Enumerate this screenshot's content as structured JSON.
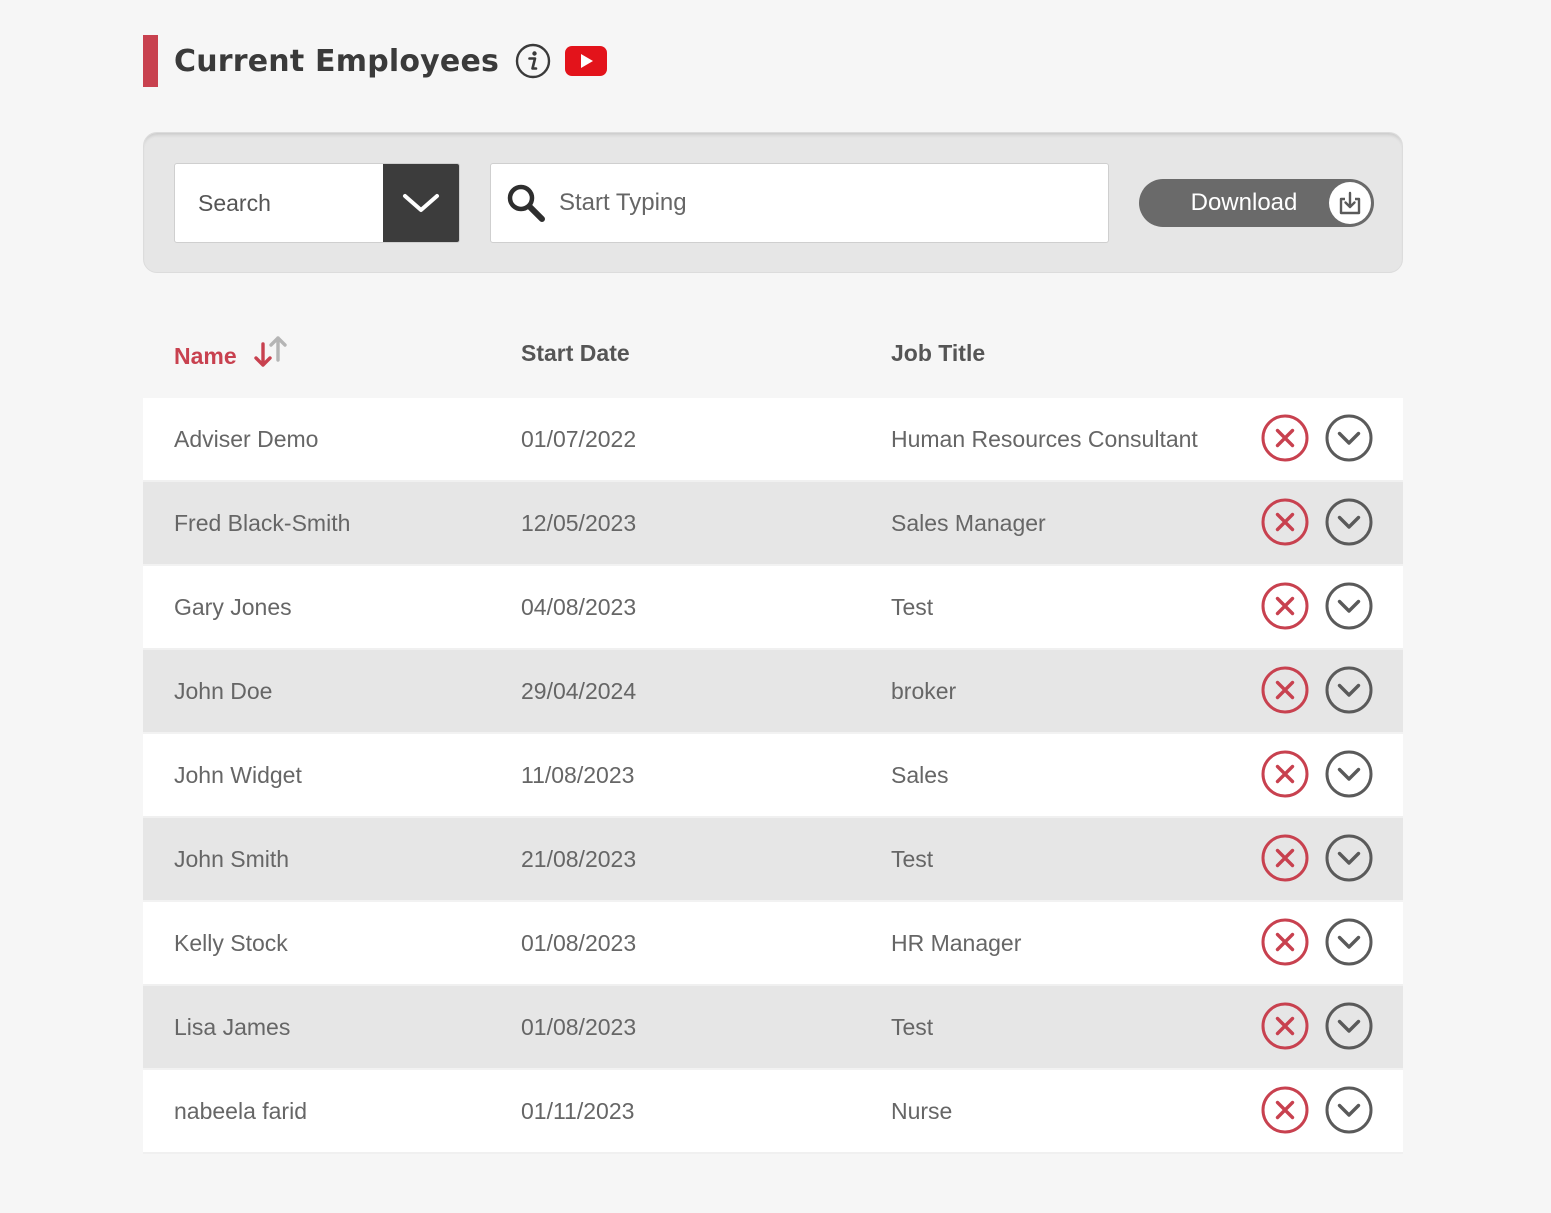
{
  "header": {
    "title": "Current Employees",
    "accent_color": "#c8414f",
    "info_icon": "info-icon",
    "video_icon": "youtube-icon"
  },
  "toolbar": {
    "search_select": {
      "value": "Search",
      "caret_icon": "chevron-down-icon"
    },
    "search_input": {
      "placeholder": "Start Typing",
      "value": "",
      "icon": "search-icon"
    },
    "download": {
      "label": "Download",
      "icon": "download-icon"
    }
  },
  "table": {
    "columns": {
      "name": "Name",
      "start_date": "Start Date",
      "job_title": "Job Title"
    },
    "sort": {
      "column": "name",
      "icon": "sort-icon"
    },
    "rows": [
      {
        "name": "Adviser Demo",
        "start_date": "01/07/2022",
        "job_title": "Human Resources Consultant"
      },
      {
        "name": "Fred Black-Smith",
        "start_date": "12/05/2023",
        "job_title": "Sales Manager"
      },
      {
        "name": "Gary Jones",
        "start_date": "04/08/2023",
        "job_title": "Test"
      },
      {
        "name": "John Doe",
        "start_date": "29/04/2024",
        "job_title": "broker"
      },
      {
        "name": "John Widget",
        "start_date": "11/08/2023",
        "job_title": "Sales"
      },
      {
        "name": "John Smith",
        "start_date": "21/08/2023",
        "job_title": "Test"
      },
      {
        "name": "Kelly Stock",
        "start_date": "01/08/2023",
        "job_title": "HR Manager"
      },
      {
        "name": "Lisa James",
        "start_date": "01/08/2023",
        "job_title": "Test"
      },
      {
        "name": "nabeela farid",
        "start_date": "01/11/2023",
        "job_title": "Nurse"
      }
    ],
    "row_actions": {
      "remove_icon": "close-circle-icon",
      "expand_icon": "chevron-down-circle-icon"
    }
  }
}
